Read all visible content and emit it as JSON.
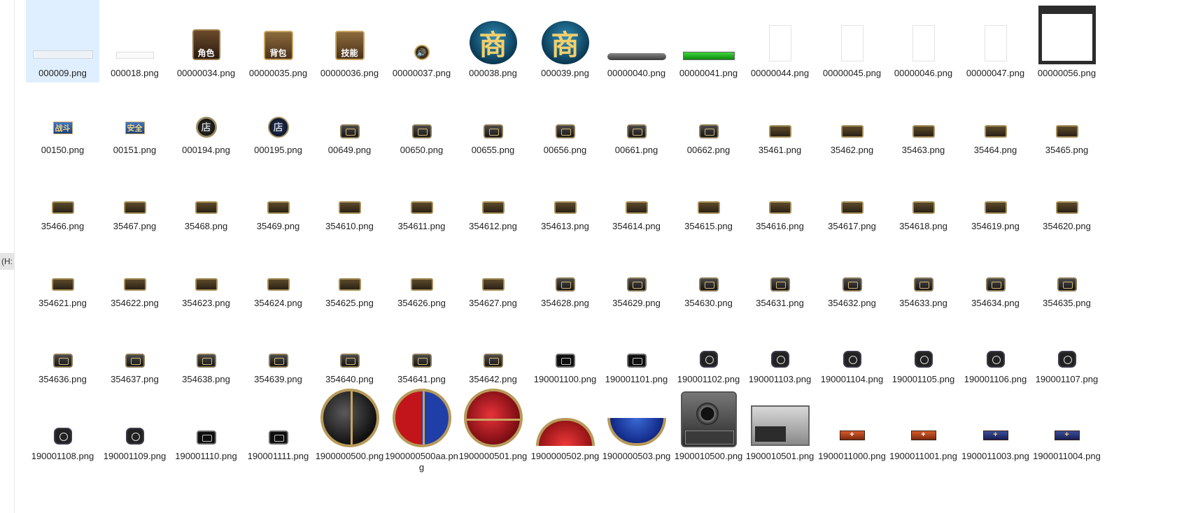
{
  "explorer": {
    "drive_label": "(H:"
  },
  "files": [
    {
      "name": "000009.png",
      "thumb": "strip",
      "selected": true
    },
    {
      "name": "000018.png",
      "thumb": "strip-small"
    },
    {
      "name": "00000034.png",
      "thumb": "char",
      "text": "角色"
    },
    {
      "name": "00000035.png",
      "thumb": "bag",
      "text": "背包"
    },
    {
      "name": "00000036.png",
      "thumb": "bag",
      "text": "技能"
    },
    {
      "name": "00000037.png",
      "thumb": "spk",
      "text": "🔊"
    },
    {
      "name": "000038.png",
      "thumb": "shop",
      "text": "商"
    },
    {
      "name": "000039.png",
      "thumb": "shop",
      "text": "商"
    },
    {
      "name": "00000040.png",
      "thumb": "bar-frame"
    },
    {
      "name": "00000041.png",
      "thumb": "bar-green"
    },
    {
      "name": "00000044.png",
      "thumb": "blank"
    },
    {
      "name": "00000045.png",
      "thumb": "blank"
    },
    {
      "name": "00000046.png",
      "thumb": "blank"
    },
    {
      "name": "00000047.png",
      "thumb": "blank"
    },
    {
      "name": "00000056.png",
      "thumb": "frame56"
    },
    {
      "name": "00150.png",
      "thumb": "tag",
      "text": "战斗"
    },
    {
      "name": "00151.png",
      "thumb": "tag",
      "text": "安全"
    },
    {
      "name": "000194.png",
      "thumb": "coin",
      "text": "店"
    },
    {
      "name": "000195.png",
      "thumb": "coin-blue",
      "text": "店"
    },
    {
      "name": "00649.png",
      "thumb": "btn"
    },
    {
      "name": "00650.png",
      "thumb": "btn"
    },
    {
      "name": "00655.png",
      "thumb": "btn"
    },
    {
      "name": "00656.png",
      "thumb": "btn"
    },
    {
      "name": "00661.png",
      "thumb": "btn"
    },
    {
      "name": "00662.png",
      "thumb": "btn"
    },
    {
      "name": "35461.png",
      "thumb": "wide"
    },
    {
      "name": "35462.png",
      "thumb": "wide"
    },
    {
      "name": "35463.png",
      "thumb": "wide"
    },
    {
      "name": "35464.png",
      "thumb": "wide"
    },
    {
      "name": "35465.png",
      "thumb": "wide"
    },
    {
      "name": "35466.png",
      "thumb": "wide"
    },
    {
      "name": "35467.png",
      "thumb": "wide"
    },
    {
      "name": "35468.png",
      "thumb": "wide"
    },
    {
      "name": "35469.png",
      "thumb": "wide"
    },
    {
      "name": "354610.png",
      "thumb": "wide"
    },
    {
      "name": "354611.png",
      "thumb": "wide"
    },
    {
      "name": "354612.png",
      "thumb": "wide"
    },
    {
      "name": "354613.png",
      "thumb": "wide"
    },
    {
      "name": "354614.png",
      "thumb": "wide"
    },
    {
      "name": "354615.png",
      "thumb": "wide"
    },
    {
      "name": "354616.png",
      "thumb": "wide"
    },
    {
      "name": "354617.png",
      "thumb": "wide"
    },
    {
      "name": "354618.png",
      "thumb": "wide"
    },
    {
      "name": "354619.png",
      "thumb": "wide"
    },
    {
      "name": "354620.png",
      "thumb": "wide"
    },
    {
      "name": "354621.png",
      "thumb": "wide"
    },
    {
      "name": "354622.png",
      "thumb": "wide"
    },
    {
      "name": "354623.png",
      "thumb": "wide"
    },
    {
      "name": "354624.png",
      "thumb": "wide"
    },
    {
      "name": "354625.png",
      "thumb": "wide"
    },
    {
      "name": "354626.png",
      "thumb": "wide"
    },
    {
      "name": "354627.png",
      "thumb": "wide"
    },
    {
      "name": "354628.png",
      "thumb": "btn"
    },
    {
      "name": "354629.png",
      "thumb": "btn"
    },
    {
      "name": "354630.png",
      "thumb": "btn"
    },
    {
      "name": "354631.png",
      "thumb": "btn"
    },
    {
      "name": "354632.png",
      "thumb": "btn"
    },
    {
      "name": "354633.png",
      "thumb": "btn"
    },
    {
      "name": "354634.png",
      "thumb": "btn"
    },
    {
      "name": "354635.png",
      "thumb": "btn"
    },
    {
      "name": "354636.png",
      "thumb": "btn"
    },
    {
      "name": "354637.png",
      "thumb": "btn"
    },
    {
      "name": "354638.png",
      "thumb": "btn"
    },
    {
      "name": "354639.png",
      "thumb": "btn"
    },
    {
      "name": "354640.png",
      "thumb": "btn"
    },
    {
      "name": "354641.png",
      "thumb": "btn"
    },
    {
      "name": "354642.png",
      "thumb": "btn"
    },
    {
      "name": "190001100.png",
      "thumb": "btn-dark"
    },
    {
      "name": "190001101.png",
      "thumb": "btn-dark"
    },
    {
      "name": "190001102.png",
      "thumb": "btn-round"
    },
    {
      "name": "190001103.png",
      "thumb": "btn-round"
    },
    {
      "name": "190001104.png",
      "thumb": "btn-round"
    },
    {
      "name": "190001105.png",
      "thumb": "btn-round"
    },
    {
      "name": "190001106.png",
      "thumb": "btn-round"
    },
    {
      "name": "190001107.png",
      "thumb": "btn-round"
    },
    {
      "name": "190001108.png",
      "thumb": "btn-round"
    },
    {
      "name": "190001109.png",
      "thumb": "btn-round"
    },
    {
      "name": "190001110.png",
      "thumb": "btn-dark"
    },
    {
      "name": "190001111.png",
      "thumb": "btn-dark"
    },
    {
      "name": "1900000500.png",
      "thumb": "orb-black"
    },
    {
      "name": "1900000500aa.png",
      "thumb": "orb-redblue"
    },
    {
      "name": "1900000501.png",
      "thumb": "orb-red"
    },
    {
      "name": "1900000502.png",
      "thumb": "half-red"
    },
    {
      "name": "1900000503.png",
      "thumb": "half-blue"
    },
    {
      "name": "1900010500.png",
      "thumb": "mech"
    },
    {
      "name": "1900010501.png",
      "thumb": "panel"
    },
    {
      "name": "1900011000.png",
      "thumb": "plus",
      "text": "+"
    },
    {
      "name": "1900011001.png",
      "thumb": "plus",
      "text": "+"
    },
    {
      "name": "1900011003.png",
      "thumb": "plus-blue",
      "text": "+"
    },
    {
      "name": "1900011004.png",
      "thumb": "plus-blue",
      "text": "+"
    }
  ]
}
